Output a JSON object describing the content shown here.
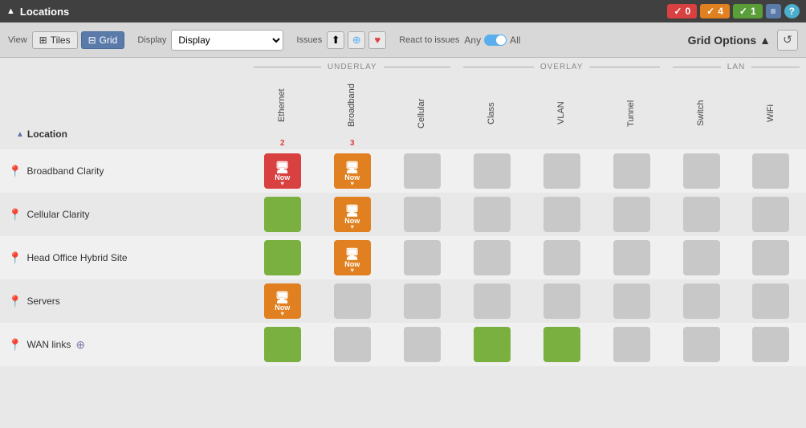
{
  "app": {
    "title": "Locations",
    "arrow_icon": "▲"
  },
  "badges": [
    {
      "id": "red",
      "icon": "✓",
      "count": "0",
      "color": "badge-red"
    },
    {
      "id": "orange",
      "icon": "✓",
      "count": "4",
      "color": "badge-orange"
    },
    {
      "id": "green",
      "icon": "✓",
      "count": "1",
      "color": "badge-green"
    }
  ],
  "toolbar": {
    "view_label": "View",
    "tiles_label": "Tiles",
    "grid_label": "Grid",
    "display_label": "Display",
    "display_value": "Display",
    "issues_label": "Issues",
    "react_label": "React to issues",
    "any_label": "Any",
    "all_label": "All",
    "grid_options_label": "Grid Options"
  },
  "columns": {
    "underlay_label": "UNDERLAY",
    "overlay_label": "OVERLAY",
    "lan_label": "LAN",
    "headers": [
      {
        "id": "ethernet",
        "label": "Ethernet",
        "count": "2",
        "section": "underlay"
      },
      {
        "id": "broadband",
        "label": "Broadband",
        "count": "3",
        "section": "underlay"
      },
      {
        "id": "cellular",
        "label": "Cellular",
        "count": "",
        "section": "underlay"
      },
      {
        "id": "class",
        "label": "Class",
        "count": "",
        "section": "overlay"
      },
      {
        "id": "vlan",
        "label": "VLAN",
        "count": "",
        "section": "overlay"
      },
      {
        "id": "tunnel",
        "label": "Tunnel",
        "count": "",
        "section": "overlay"
      },
      {
        "id": "switch",
        "label": "Switch",
        "count": "",
        "section": "lan"
      },
      {
        "id": "wifi",
        "label": "WiFi",
        "count": "",
        "section": "lan"
      }
    ]
  },
  "location_header": "Location",
  "rows": [
    {
      "id": "broadband-clarity",
      "name": "Broadband Clarity",
      "pin_color": "orange",
      "cells": [
        {
          "type": "card",
          "color": "red",
          "icon": "🖥",
          "time": "Now",
          "heart": "♥"
        },
        {
          "type": "card",
          "color": "orange",
          "icon": "🖥",
          "time": "Now",
          "heart": "♥"
        },
        {
          "type": "empty"
        },
        {
          "type": "empty"
        },
        {
          "type": "empty"
        },
        {
          "type": "empty"
        },
        {
          "type": "empty"
        },
        {
          "type": "empty"
        }
      ]
    },
    {
      "id": "cellular-clarity",
      "name": "Cellular Clarity",
      "pin_color": "orange",
      "cells": [
        {
          "type": "green"
        },
        {
          "type": "card",
          "color": "orange",
          "icon": "🖥",
          "time": "Now",
          "heart": "♥"
        },
        {
          "type": "empty"
        },
        {
          "type": "empty"
        },
        {
          "type": "empty"
        },
        {
          "type": "empty"
        },
        {
          "type": "empty"
        },
        {
          "type": "empty"
        }
      ]
    },
    {
      "id": "head-office",
      "name": "Head Office Hybrid Site",
      "pin_color": "orange",
      "cells": [
        {
          "type": "green"
        },
        {
          "type": "card",
          "color": "orange",
          "icon": "🖥",
          "time": "Now",
          "heart": "♥"
        },
        {
          "type": "empty"
        },
        {
          "type": "empty"
        },
        {
          "type": "empty"
        },
        {
          "type": "empty"
        },
        {
          "type": "empty"
        },
        {
          "type": "empty"
        }
      ]
    },
    {
      "id": "servers",
      "name": "Servers",
      "pin_color": "orange",
      "cells": [
        {
          "type": "card",
          "color": "orange",
          "icon": "🖥",
          "time": "Now",
          "heart": "♥"
        },
        {
          "type": "empty"
        },
        {
          "type": "empty"
        },
        {
          "type": "empty"
        },
        {
          "type": "empty"
        },
        {
          "type": "empty"
        },
        {
          "type": "empty"
        },
        {
          "type": "empty"
        }
      ]
    },
    {
      "id": "wan-links",
      "name": "WAN links",
      "pin_color": "orange",
      "has_special_icon": true,
      "cells": [
        {
          "type": "green"
        },
        {
          "type": "empty"
        },
        {
          "type": "empty"
        },
        {
          "type": "green"
        },
        {
          "type": "green"
        },
        {
          "type": "empty"
        },
        {
          "type": "empty"
        },
        {
          "type": "empty"
        }
      ]
    }
  ]
}
